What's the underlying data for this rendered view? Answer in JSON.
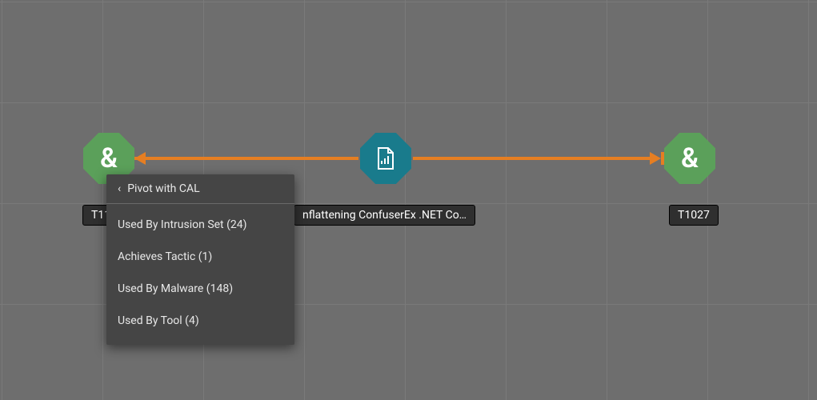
{
  "nodes": {
    "left": {
      "label": "T11",
      "glyph": "&"
    },
    "center": {
      "label": "nflattening ConfuserEx .NET Co…"
    },
    "right": {
      "label": "T1027",
      "glyph": "&"
    }
  },
  "menu": {
    "header": "Pivot with CAL",
    "items": [
      "Used By Intrusion Set (24)",
      "Achieves Tactic (1)",
      "Used By Malware (148)",
      "Used By Tool (4)"
    ]
  },
  "colors": {
    "green": "#5ba05a",
    "teal": "#197b8c",
    "orange": "#e67e22",
    "bg": "#6e6e6e",
    "menu": "#454545"
  }
}
